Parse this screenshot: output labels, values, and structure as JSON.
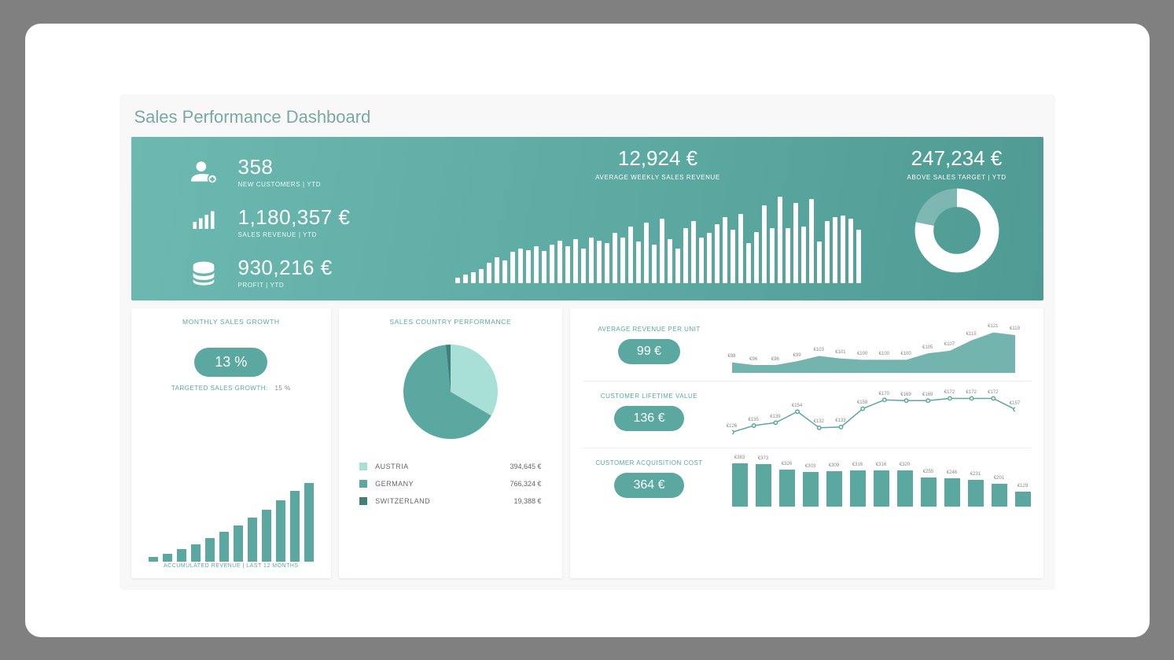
{
  "title": "Sales Performance Dashboard",
  "hero": {
    "kpis": [
      {
        "icon": "user-plus",
        "value": "358",
        "label": "NEW CUSTOMERS | YTD"
      },
      {
        "icon": "bars",
        "value": "1,180,357 €",
        "label": "SALES REVENUE | YTD"
      },
      {
        "icon": "coins",
        "value": "930,216 €",
        "label": "PROFIT | YTD"
      }
    ],
    "weekly": {
      "value": "12,924 €",
      "label": "AVERAGE WEEKLY SALES REVENUE"
    },
    "target": {
      "value": "247,234 €",
      "label": "ABOVE SALES TARGET | YTD",
      "donut_percent": 78
    }
  },
  "growth": {
    "title": "MONTHLY SALES GROWTH",
    "pill": "13 %",
    "subtext_label": "TARGETED SALES GROWTH:",
    "subtext_value": "15 %",
    "footer": "ACCUMULATED REVENUE | LAST 12 MONTHS"
  },
  "country": {
    "title": "SALES COUNTRY PERFORMANCE",
    "rows": [
      {
        "color": "#a8e0d8",
        "name": "AUSTRIA",
        "value": "394,645 €"
      },
      {
        "color": "#5aa8a0",
        "name": "GERMANY",
        "value": "766,324 €"
      },
      {
        "color": "#3f807a",
        "name": "SWITZERLAND",
        "value": "19,388 €"
      }
    ]
  },
  "metrics": {
    "arpu": {
      "title": "AVERAGE REVENUE PER UNIT",
      "pill": "99 €"
    },
    "clv": {
      "title": "CUSTOMER LIFETIME VALUE",
      "pill": "136 €"
    },
    "cac": {
      "title": "CUSTOMER ACQUISITION COST",
      "pill": "364 €"
    }
  },
  "chart_data": [
    {
      "type": "bar",
      "title": "AVERAGE WEEKLY SALES REVENUE",
      "ylabel": "€",
      "ylim": [
        0,
        100
      ],
      "values": [
        6,
        9,
        12,
        15,
        22,
        28,
        25,
        34,
        38,
        36,
        40,
        35,
        42,
        46,
        40,
        48,
        38,
        50,
        46,
        44,
        55,
        50,
        62,
        45,
        66,
        42,
        70,
        48,
        38,
        60,
        68,
        50,
        55,
        64,
        72,
        58,
        76,
        44,
        56,
        85,
        60,
        95,
        60,
        88,
        62,
        92,
        45,
        68,
        72,
        74,
        70,
        58
      ]
    },
    {
      "type": "pie",
      "title": "ABOVE SALES TARGET | YTD",
      "series": [
        {
          "name": "achieved",
          "value": 78,
          "color": "#ffffff"
        },
        {
          "name": "remaining",
          "value": 22,
          "color": "rgba(255,255,255,0.25)"
        }
      ]
    },
    {
      "type": "bar",
      "title": "ACCUMULATED REVENUE | LAST 12 MONTHS",
      "values": [
        6,
        10,
        16,
        22,
        30,
        38,
        46,
        56,
        66,
        78,
        90,
        100
      ]
    },
    {
      "type": "pie",
      "title": "SALES COUNTRY PERFORMANCE",
      "series": [
        {
          "name": "AUSTRIA",
          "value": 394645,
          "color": "#a8e0d8"
        },
        {
          "name": "GERMANY",
          "value": 766324,
          "color": "#5aa8a0"
        },
        {
          "name": "SWITZERLAND",
          "value": 19388,
          "color": "#3f807a"
        }
      ]
    },
    {
      "type": "area",
      "title": "AVERAGE REVENUE PER UNIT",
      "ylabel": "€",
      "categories": [
        "",
        "",
        "",
        "",
        "",
        "",
        "",
        "",
        "",
        "",
        "",
        "",
        "",
        ""
      ],
      "values": [
        98,
        96,
        96,
        99,
        103,
        101,
        100,
        100,
        100,
        105,
        107,
        115,
        121,
        119
      ],
      "labels": [
        "€98",
        "€96",
        "€96",
        "€99",
        "€103",
        "€101",
        "€100",
        "€100",
        "€100",
        "€105",
        "€107",
        "€115",
        "€121",
        "€119"
      ]
    },
    {
      "type": "line",
      "title": "CUSTOMER LIFETIME VALUE",
      "ylabel": "€",
      "values": [
        126,
        135,
        139,
        154,
        132,
        133,
        158,
        170,
        169,
        169,
        172,
        172,
        172,
        157
      ],
      "labels": [
        "€126",
        "€135",
        "€139",
        "€154",
        "€132",
        "€133",
        "€158",
        "€170",
        "€169",
        "€169",
        "€172",
        "€172",
        "€172",
        "€157"
      ]
    },
    {
      "type": "bar",
      "title": "CUSTOMER ACQUISITION COST",
      "ylabel": "€",
      "values": [
        383,
        373,
        326,
        303,
        309,
        316,
        316,
        320,
        255,
        246,
        231,
        201,
        129
      ],
      "labels": [
        "€383",
        "€373",
        "€326",
        "€303",
        "€309",
        "€316",
        "€316",
        "€320",
        "€255",
        "€246",
        "€231",
        "€201",
        "€129"
      ]
    }
  ]
}
